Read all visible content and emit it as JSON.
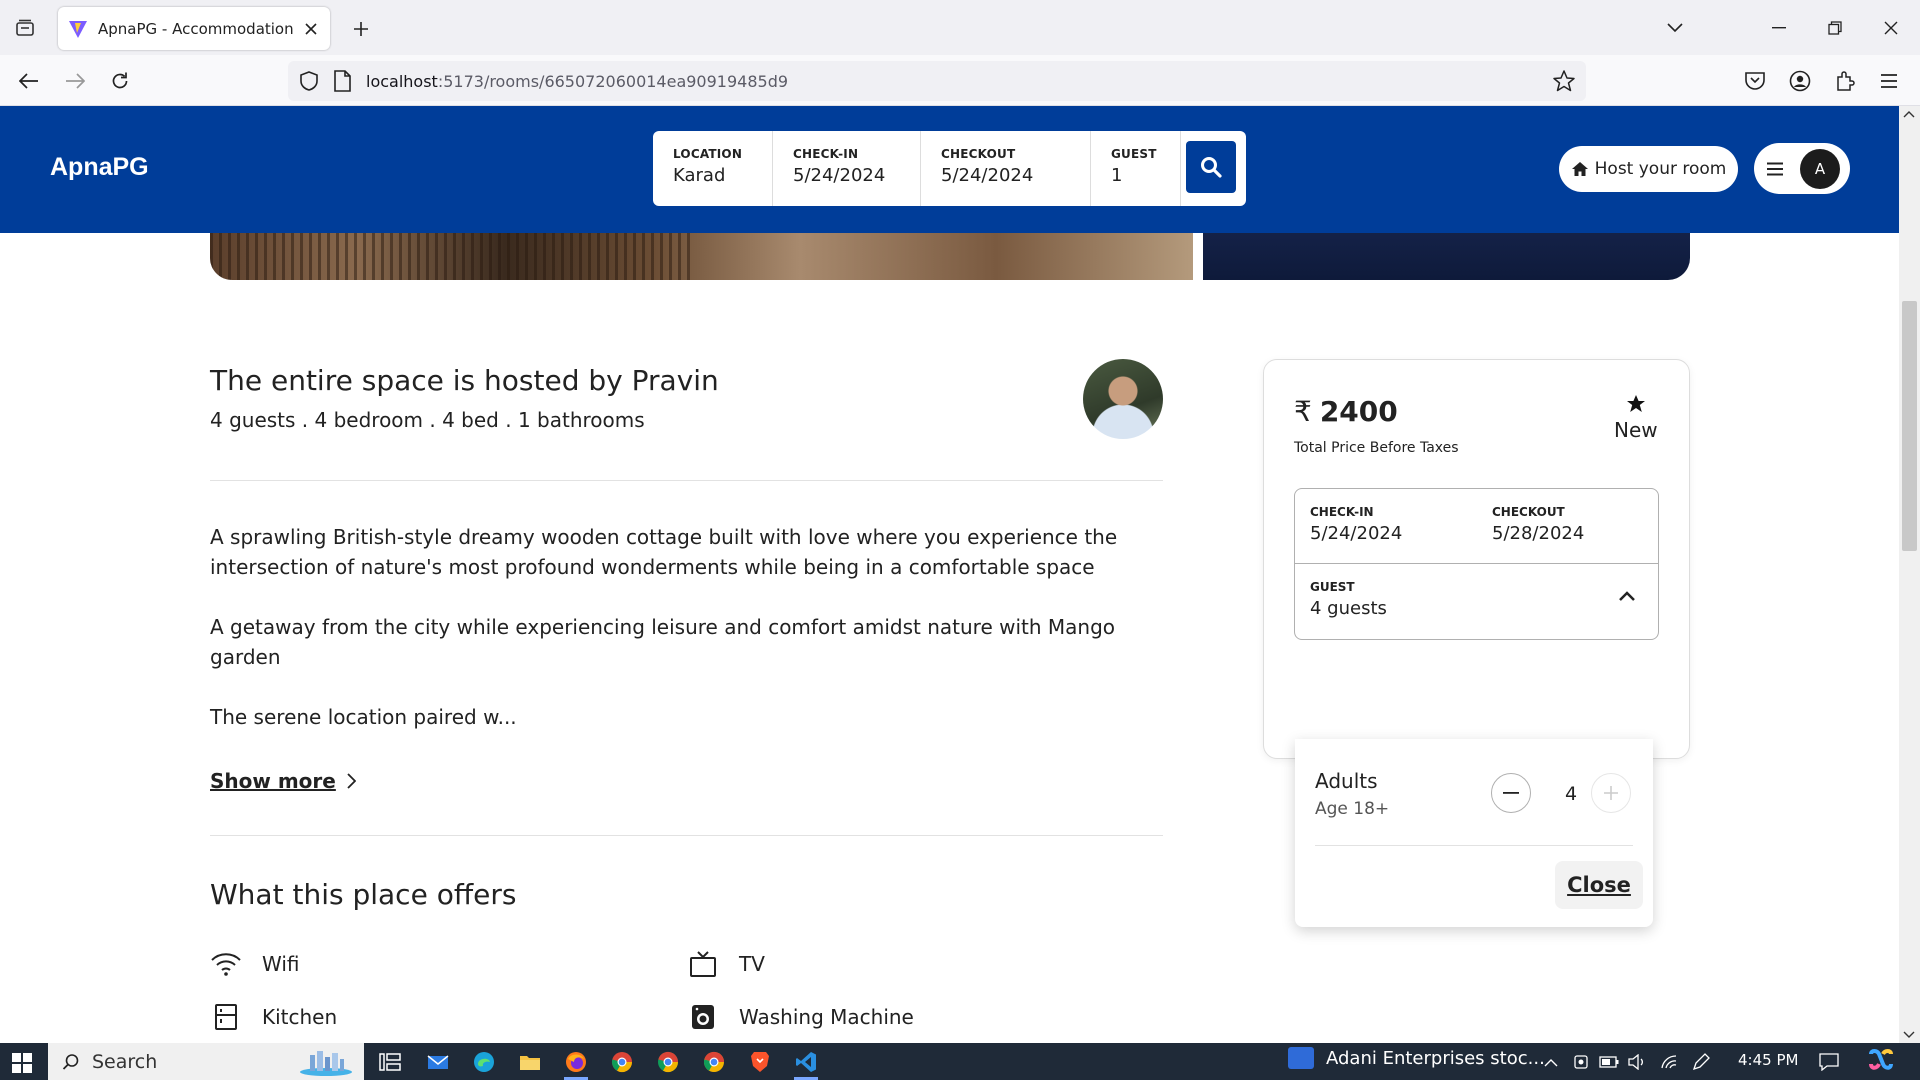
{
  "browser": {
    "tab_title": "ApnaPG - Accommodation Solutions",
    "url_host": "localhost",
    "url_path": ":5173/rooms/665072060014ea90919485d9"
  },
  "header": {
    "logo": "ApnaPG",
    "search": {
      "location_label": "LOCATION",
      "location_value": "Karad",
      "checkin_label": "CHECK-IN",
      "checkin_value": "5/24/2024",
      "checkout_label": "CHECKOUT",
      "checkout_value": "5/24/2024",
      "guest_label": "GUEST",
      "guest_value": "1"
    },
    "host_button": "Host your room",
    "avatar_letter": "A"
  },
  "listing": {
    "host_title": "The entire space is hosted by Pravin",
    "host_subtitle": "4 guests . 4 bedroom . 4 bed . 1 bathrooms",
    "description": [
      "A sprawling British-style dreamy wooden cottage built with love where you experience the intersection of nature's most profound wonderments while being in a comfortable space",
      "A getaway from the city while experiencing leisure and comfort amidst nature with Mango garden",
      "The serene location paired w..."
    ],
    "show_more": "Show more",
    "offers_title": "What this place offers",
    "amenities": [
      {
        "label": "Wifi",
        "icon": "wifi-icon"
      },
      {
        "label": "TV",
        "icon": "tv-icon"
      },
      {
        "label": "Kitchen",
        "icon": "kitchen-icon"
      },
      {
        "label": "Washing Machine",
        "icon": "washing-machine-icon"
      }
    ]
  },
  "booking": {
    "price": "2400",
    "price_sub": "Total Price Before Taxes",
    "rating_label": "New",
    "checkin_label": "CHECK-IN",
    "checkin_value": "5/24/2024",
    "checkout_label": "CHECKOUT",
    "checkout_value": "5/28/2024",
    "guest_label": "GUEST",
    "guest_value": "4 guests",
    "dropdown": {
      "adults_title": "Adults",
      "adults_sub": "Age 18+",
      "adults_count": "4",
      "close_label": "Close"
    }
  },
  "taskbar": {
    "search_label": "Search",
    "news": "Adani Enterprises stoc...",
    "time": "4:45 PM"
  },
  "colors": {
    "brand": "#003d99",
    "taskbar": "#1f2a38"
  }
}
